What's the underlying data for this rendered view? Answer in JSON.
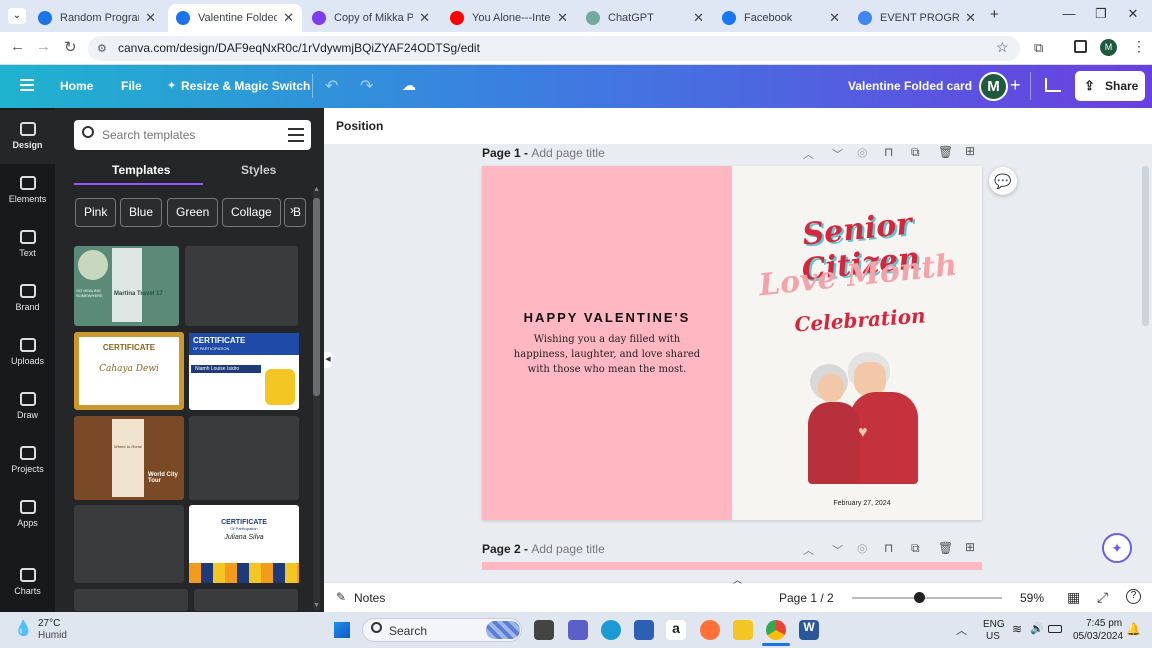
{
  "browser": {
    "tabs": [
      {
        "label": "Random Program - C",
        "icon_color": "#1b74e8"
      },
      {
        "label": "Valentine Folded card",
        "icon_color": "#1b74e8",
        "active": true
      },
      {
        "label": "Copy of Mikka Peralt",
        "icon_color": "#7d3cf0"
      },
      {
        "label": "You Alone---Integrity",
        "icon_color": "#ff0000"
      },
      {
        "label": "ChatGPT",
        "icon_color": "#74aa9c"
      },
      {
        "label": "Facebook",
        "icon_color": "#1877f2"
      },
      {
        "label": "EVENT PROGRAM - C",
        "icon_color": "#4285f4"
      }
    ],
    "new_tab": "+",
    "url": "canva.com/design/DAF9eqNxR0c/1rVdywmjBQiZYAF24ODTSg/edit",
    "profile_initial": "M"
  },
  "header": {
    "home": "Home",
    "file": "File",
    "resize": "Resize & Magic Switch",
    "title": "Valentine Folded card",
    "avatar": "M",
    "share": "Share"
  },
  "rail": [
    {
      "label": "Design",
      "icon": "design-icon"
    },
    {
      "label": "Elements",
      "icon": "elements-icon"
    },
    {
      "label": "Text",
      "icon": "text-icon"
    },
    {
      "label": "Brand",
      "icon": "brand-icon"
    },
    {
      "label": "Uploads",
      "icon": "uploads-icon"
    },
    {
      "label": "Draw",
      "icon": "draw-icon"
    },
    {
      "label": "Projects",
      "icon": "projects-icon"
    },
    {
      "label": "Apps",
      "icon": "apps-icon"
    },
    {
      "label": "Charts",
      "icon": "charts-icon"
    }
  ],
  "panel": {
    "search_placeholder": "Search templates",
    "tabs": [
      "Templates",
      "Styles"
    ],
    "chips": [
      "Pink",
      "Blue",
      "Green",
      "Collage",
      "B"
    ],
    "thumbs": {
      "travel": {
        "label": "Martina Travel 17",
        "sub": "GO HEALING SOMEWHERE"
      },
      "cert1": {
        "title": "CERTIFICATE",
        "name": "Cahaya Dewi"
      },
      "cert2": {
        "title": "CERTIFICATE",
        "sub": "OF PARTICIPATION",
        "name": "Niamh Louise Isidro"
      },
      "world": {
        "title": "World City Tour",
        "sub": "Where to Rome"
      },
      "cert3": {
        "title": "CERTIFICATE",
        "sub": "Of Participation",
        "name": "Juliana Silva"
      }
    }
  },
  "editor": {
    "position_label": "Position",
    "page1_label": "Page 1 - ",
    "page1_title_placeholder": "Add page title",
    "page2_label": "Page 2 - ",
    "page2_title_placeholder": "Add page title",
    "card_heading": "HAPPY VALENTINE'S",
    "card_message": "Wishing you a day filled with happiness, laughter, and love shared with those who mean the most.",
    "art_line1": "Senior Citizen",
    "art_line2": "Love Month",
    "art_line3": "Celebration",
    "art_date": "February 27, 2024",
    "notes": "Notes",
    "page_indicator": "Page 1 / 2",
    "zoom": "59%",
    "zoom_level": 0.59
  },
  "taskbar": {
    "temp": "27°C",
    "weather": "Humid",
    "search": "Search",
    "lang1": "ENG",
    "lang2": "US",
    "time": "7:45 pm",
    "date": "05/03/2024"
  }
}
